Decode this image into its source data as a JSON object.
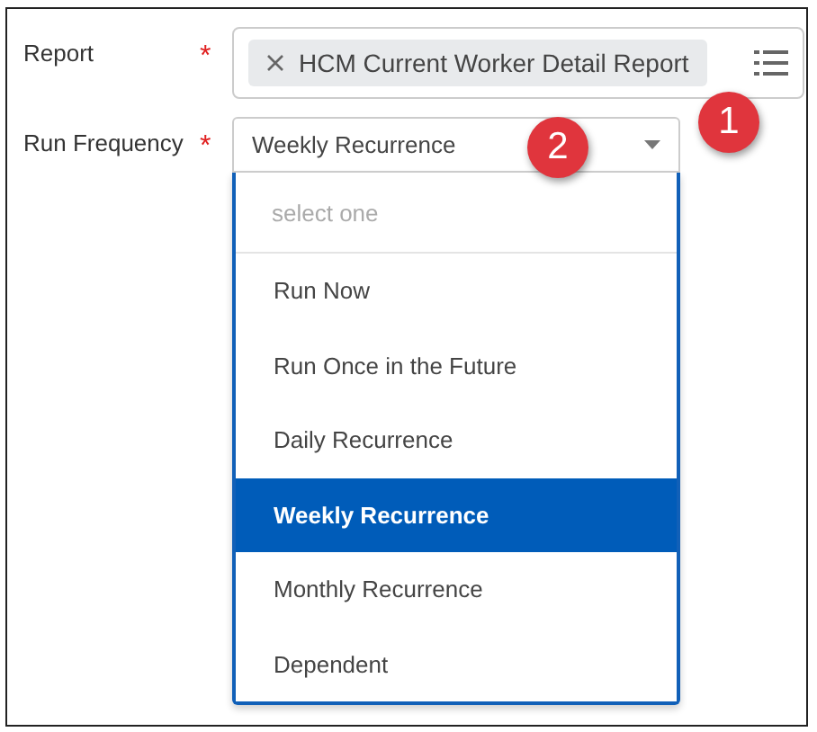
{
  "fields": [
    {
      "label": "Report",
      "required_mark": "*",
      "chip": "HCM Current Worker Detail Report",
      "badge": "1"
    },
    {
      "label": "Run Frequency",
      "required_mark": "*",
      "value": "Weekly Recurrence",
      "badge": "2"
    }
  ],
  "dropdown": {
    "prompt": "select one",
    "options": [
      {
        "label": "Run Now",
        "selected": false
      },
      {
        "label": "Run Once in the Future",
        "selected": false
      },
      {
        "label": "Daily Recurrence",
        "selected": false
      },
      {
        "label": "Weekly Recurrence",
        "selected": true
      },
      {
        "label": "Monthly Recurrence",
        "selected": false
      },
      {
        "label": "Dependent",
        "selected": false
      }
    ]
  }
}
